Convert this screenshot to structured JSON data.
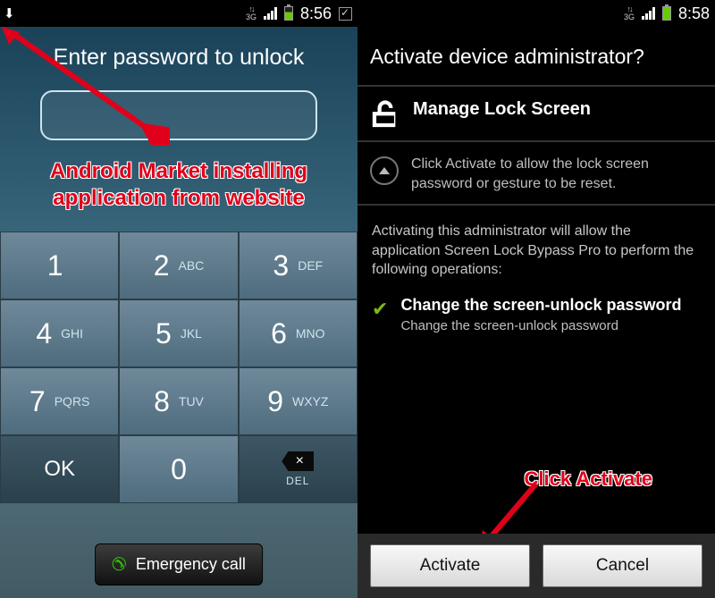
{
  "left": {
    "status": {
      "time": "8:56"
    },
    "title": "Enter password to unlock",
    "annotation": "Android Market installing application from website",
    "keys": {
      "r1c1": {
        "n": "1",
        "l": ""
      },
      "r1c2": {
        "n": "2",
        "l": "ABC"
      },
      "r1c3": {
        "n": "3",
        "l": "DEF"
      },
      "r2c1": {
        "n": "4",
        "l": "GHI"
      },
      "r2c2": {
        "n": "5",
        "l": "JKL"
      },
      "r2c3": {
        "n": "6",
        "l": "MNO"
      },
      "r3c1": {
        "n": "7",
        "l": "PQRS"
      },
      "r3c2": {
        "n": "8",
        "l": "TUV"
      },
      "r3c3": {
        "n": "9",
        "l": "WXYZ"
      },
      "ok": "OK",
      "zero": "0",
      "del": "DEL"
    },
    "emergency": "Emergency call"
  },
  "right": {
    "status": {
      "time": "8:58"
    },
    "title": "Activate device administrator?",
    "app_name": "Manage Lock Screen",
    "hint": "Click Activate to allow the lock screen password or gesture to be reset.",
    "explain": "Activating this administrator will allow the application Screen Lock Bypass Pro to perform the following operations:",
    "op_title": "Change the screen-unlock password",
    "op_sub": "Change the screen-unlock password",
    "annotation": "Click Activate",
    "activate": "Activate",
    "cancel": "Cancel"
  }
}
